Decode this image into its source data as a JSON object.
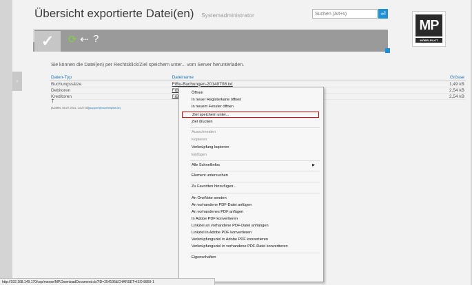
{
  "header": {
    "title": "Übersicht exportierte Datei(en)",
    "role": "Systemadministrator"
  },
  "search": {
    "placeholder": "Suchen (Alt+s)"
  },
  "logo": {
    "mark": "MP",
    "tagline": "MÖBELPILOT"
  },
  "toolbar": {
    "check": "✓",
    "refresh": "⟳",
    "back": "⇠",
    "help": "?"
  },
  "content": {
    "hint": "Sie können die Datei(en) per Rechtsklick/Ziel speichern unter... vom Server herunterladen.",
    "columns": [
      "Daten-Typ",
      "Dateiname",
      "Grösse"
    ],
    "rows": [
      {
        "type": "Buchungssätze",
        "file": "FiBu-Buchungen-20140708.txt",
        "size": "1,49 kB"
      },
      {
        "type": "Debitoren",
        "file": "FiBu-Debitoren-201407",
        "size": "2,54 kB"
      },
      {
        "type": "Kreditoren",
        "file": "FiBu-Kreditoren-201407",
        "size": "2,54 kB"
      }
    ],
    "footer_prefix": "[ADMIN, 08.07.2014, 14:27:33]",
    "footer_mail": "[support@moebelpilot.de]"
  },
  "context_menu": {
    "items": [
      "Öffnen",
      "In neuer Registerkarte öffnen",
      "In neuem Fenster öffnen",
      "Ziel speichern unter...",
      "Ziel drucken",
      "Ausschneiden",
      "Kopieren",
      "Verknüpfung kopieren",
      "Einfügen",
      "Alle Schnellinfos",
      "Element untersuchen",
      "Zu Favoriten hinzufügen...",
      "An OneNote senden",
      "An vorhandene PDF-Datei anfügen",
      "An vorhandenes PDF anfügen",
      "In Adobe PDF konvertieren",
      "Linkziel an vorhandene PDF-Datei anhängen",
      "Linkziel in Adobe PDF konvertieren",
      "Verknüpfungsziel in Adobe PDF konvertieren",
      "Verknüpfungsziel in vorhandene PDF-Datei konvertieren",
      "Eigenschaften"
    ]
  },
  "statusbar": {
    "url": "http://192.168.149.170/csp/messe/MP.DownloadDocument.cls?ID=254195&CHARSET=ISO-8859-1"
  }
}
